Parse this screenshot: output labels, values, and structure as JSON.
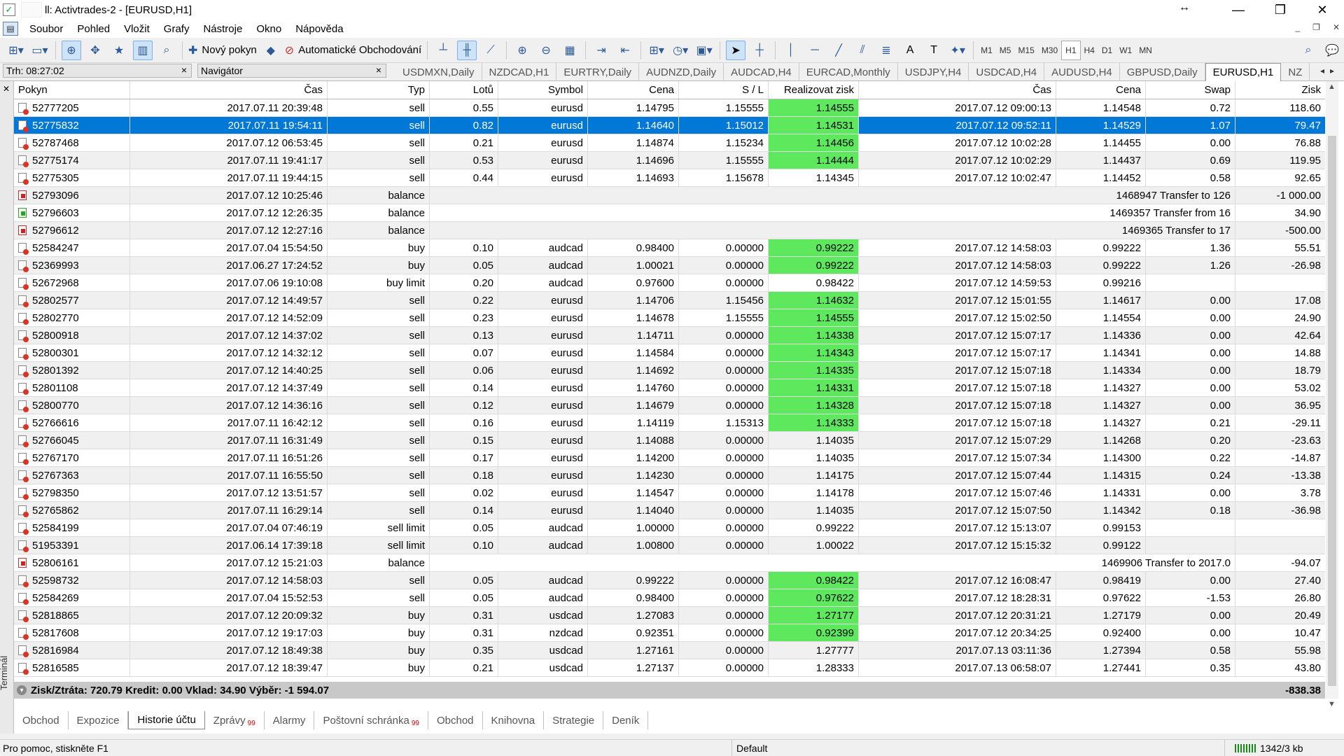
{
  "window": {
    "title": "ll: Activtrades-2 - [EURUSD,H1]",
    "sizer_glyph": "↔",
    "buttons": [
      "—",
      "❐",
      "✕"
    ]
  },
  "menu": [
    "Soubor",
    "Pohled",
    "Vložit",
    "Grafy",
    "Nástroje",
    "Okno",
    "Nápověda"
  ],
  "mdi_buttons": [
    "_",
    "❐",
    "✕"
  ],
  "toolbar": {
    "new_order_label": "Nový pokyn",
    "auto_trading_label": "Automatické Obchodování",
    "timeframes": [
      "M1",
      "M5",
      "M15",
      "M30",
      "H1",
      "H4",
      "D1",
      "W1",
      "MN"
    ],
    "active_timeframe": "H1"
  },
  "panels": {
    "market_watch": "Trh: 08:27:02",
    "navigator": "Navigátor",
    "close_glyph": "×"
  },
  "chart_tabs": [
    "USDMXN,Daily",
    "NZDCAD,H1",
    "EURTRY,Daily",
    "AUDNZD,Daily",
    "AUDCAD,H4",
    "EURCAD,Monthly",
    "USDJPY,H4",
    "USDCAD,H4",
    "AUDUSD,H4",
    "GBPUSD,Daily",
    "EURUSD,H1",
    "NZ"
  ],
  "active_chart_tab": "EURUSD,H1",
  "columns": [
    "Pokyn",
    "Čas",
    "Typ",
    "Lotů",
    "Symbol",
    "Cena",
    "S / L",
    "Realizovat zisk",
    "Čas",
    "Cena",
    "Swap",
    "Zisk"
  ],
  "rows": [
    {
      "kind": "trade",
      "order": "52777205",
      "open_time": "2017.07.11 20:39:48",
      "type": "sell",
      "lots": "0.55",
      "symbol": "eurusd",
      "open_price": "1.14795",
      "sl": "1.15555",
      "tp": "1.14555",
      "tp_hit": true,
      "close_time": "2017.07.12 09:00:13",
      "close_price": "1.14548",
      "swap": "0.72",
      "profit": "118.60"
    },
    {
      "kind": "trade",
      "order": "52775832",
      "open_time": "2017.07.11 19:54:11",
      "type": "sell",
      "lots": "0.82",
      "symbol": "eurusd",
      "open_price": "1.14640",
      "sl": "1.15012",
      "tp": "1.14531",
      "tp_hit": true,
      "close_time": "2017.07.12 09:52:11",
      "close_price": "1.14529",
      "swap": "1.07",
      "profit": "79.47",
      "selected": true
    },
    {
      "kind": "trade",
      "order": "52787468",
      "open_time": "2017.07.12 06:53:45",
      "type": "sell",
      "lots": "0.21",
      "symbol": "eurusd",
      "open_price": "1.14874",
      "sl": "1.15234",
      "tp": "1.14456",
      "tp_hit": true,
      "close_time": "2017.07.12 10:02:28",
      "close_price": "1.14455",
      "swap": "0.00",
      "profit": "76.88"
    },
    {
      "kind": "trade",
      "order": "52775174",
      "open_time": "2017.07.11 19:41:17",
      "type": "sell",
      "lots": "0.53",
      "symbol": "eurusd",
      "open_price": "1.14696",
      "sl": "1.15555",
      "tp": "1.14444",
      "tp_hit": true,
      "close_time": "2017.07.12 10:02:29",
      "close_price": "1.14437",
      "swap": "0.69",
      "profit": "119.95"
    },
    {
      "kind": "trade",
      "order": "52775305",
      "open_time": "2017.07.11 19:44:15",
      "type": "sell",
      "lots": "0.44",
      "symbol": "eurusd",
      "open_price": "1.14693",
      "sl": "1.15678",
      "tp": "1.14345",
      "tp_hit": false,
      "close_time": "2017.07.12 10:02:47",
      "close_price": "1.14452",
      "swap": "0.58",
      "profit": "92.65"
    },
    {
      "kind": "balance",
      "order": "52793096",
      "open_time": "2017.07.12 10:25:46",
      "type": "balance",
      "note": "1468947 Transfer to 126",
      "profit": "-1 000.00",
      "icon": "red"
    },
    {
      "kind": "balance",
      "order": "52796603",
      "open_time": "2017.07.12 12:26:35",
      "type": "balance",
      "note": "1469357 Transfer from 16",
      "profit": "34.90",
      "icon": "green"
    },
    {
      "kind": "balance",
      "order": "52796612",
      "open_time": "2017.07.12 12:27:16",
      "type": "balance",
      "note": "1469365 Transfer to 17",
      "profit": "-500.00",
      "icon": "red"
    },
    {
      "kind": "trade",
      "order": "52584247",
      "open_time": "2017.07.04 15:54:50",
      "type": "buy",
      "lots": "0.10",
      "symbol": "audcad",
      "open_price": "0.98400",
      "sl": "0.00000",
      "tp": "0.99222",
      "tp_hit": true,
      "close_time": "2017.07.12 14:58:03",
      "close_price": "0.99222",
      "swap": "1.36",
      "profit": "55.51"
    },
    {
      "kind": "trade",
      "order": "52369993",
      "open_time": "2017.06.27 17:24:52",
      "type": "buy",
      "lots": "0.05",
      "symbol": "audcad",
      "open_price": "1.00021",
      "sl": "0.00000",
      "tp": "0.99222",
      "tp_hit": true,
      "close_time": "2017.07.12 14:58:03",
      "close_price": "0.99222",
      "swap": "1.26",
      "profit": "-26.98"
    },
    {
      "kind": "trade",
      "order": "52672968",
      "open_time": "2017.07.06 19:10:08",
      "type": "buy limit",
      "lots": "0.20",
      "symbol": "audcad",
      "open_price": "0.97600",
      "sl": "0.00000",
      "tp": "0.98422",
      "tp_hit": false,
      "close_time": "2017.07.12 14:59:53",
      "close_price": "0.99216",
      "swap": "",
      "profit": ""
    },
    {
      "kind": "trade",
      "order": "52802577",
      "open_time": "2017.07.12 14:49:57",
      "type": "sell",
      "lots": "0.22",
      "symbol": "eurusd",
      "open_price": "1.14706",
      "sl": "1.15456",
      "tp": "1.14632",
      "tp_hit": true,
      "close_time": "2017.07.12 15:01:55",
      "close_price": "1.14617",
      "swap": "0.00",
      "profit": "17.08"
    },
    {
      "kind": "trade",
      "order": "52802770",
      "open_time": "2017.07.12 14:52:09",
      "type": "sell",
      "lots": "0.23",
      "symbol": "eurusd",
      "open_price": "1.14678",
      "sl": "1.15555",
      "tp": "1.14555",
      "tp_hit": true,
      "close_time": "2017.07.12 15:02:50",
      "close_price": "1.14554",
      "swap": "0.00",
      "profit": "24.90"
    },
    {
      "kind": "trade",
      "order": "52800918",
      "open_time": "2017.07.12 14:37:02",
      "type": "sell",
      "lots": "0.13",
      "symbol": "eurusd",
      "open_price": "1.14711",
      "sl": "0.00000",
      "tp": "1.14338",
      "tp_hit": true,
      "close_time": "2017.07.12 15:07:17",
      "close_price": "1.14336",
      "swap": "0.00",
      "profit": "42.64"
    },
    {
      "kind": "trade",
      "order": "52800301",
      "open_time": "2017.07.12 14:32:12",
      "type": "sell",
      "lots": "0.07",
      "symbol": "eurusd",
      "open_price": "1.14584",
      "sl": "0.00000",
      "tp": "1.14343",
      "tp_hit": true,
      "close_time": "2017.07.12 15:07:17",
      "close_price": "1.14341",
      "swap": "0.00",
      "profit": "14.88"
    },
    {
      "kind": "trade",
      "order": "52801392",
      "open_time": "2017.07.12 14:40:25",
      "type": "sell",
      "lots": "0.06",
      "symbol": "eurusd",
      "open_price": "1.14692",
      "sl": "0.00000",
      "tp": "1.14335",
      "tp_hit": true,
      "close_time": "2017.07.12 15:07:18",
      "close_price": "1.14334",
      "swap": "0.00",
      "profit": "18.79"
    },
    {
      "kind": "trade",
      "order": "52801108",
      "open_time": "2017.07.12 14:37:49",
      "type": "sell",
      "lots": "0.14",
      "symbol": "eurusd",
      "open_price": "1.14760",
      "sl": "0.00000",
      "tp": "1.14331",
      "tp_hit": true,
      "close_time": "2017.07.12 15:07:18",
      "close_price": "1.14327",
      "swap": "0.00",
      "profit": "53.02"
    },
    {
      "kind": "trade",
      "order": "52800770",
      "open_time": "2017.07.12 14:36:16",
      "type": "sell",
      "lots": "0.12",
      "symbol": "eurusd",
      "open_price": "1.14679",
      "sl": "0.00000",
      "tp": "1.14328",
      "tp_hit": true,
      "close_time": "2017.07.12 15:07:18",
      "close_price": "1.14327",
      "swap": "0.00",
      "profit": "36.95"
    },
    {
      "kind": "trade",
      "order": "52766616",
      "open_time": "2017.07.11 16:42:12",
      "type": "sell",
      "lots": "0.16",
      "symbol": "eurusd",
      "open_price": "1.14119",
      "sl": "1.15313",
      "tp": "1.14333",
      "tp_hit": true,
      "close_time": "2017.07.12 15:07:18",
      "close_price": "1.14327",
      "swap": "0.21",
      "profit": "-29.11"
    },
    {
      "kind": "trade",
      "order": "52766045",
      "open_time": "2017.07.11 16:31:49",
      "type": "sell",
      "lots": "0.15",
      "symbol": "eurusd",
      "open_price": "1.14088",
      "sl": "0.00000",
      "tp": "1.14035",
      "tp_hit": false,
      "close_time": "2017.07.12 15:07:29",
      "close_price": "1.14268",
      "swap": "0.20",
      "profit": "-23.63"
    },
    {
      "kind": "trade",
      "order": "52767170",
      "open_time": "2017.07.11 16:51:26",
      "type": "sell",
      "lots": "0.17",
      "symbol": "eurusd",
      "open_price": "1.14200",
      "sl": "0.00000",
      "tp": "1.14035",
      "tp_hit": false,
      "close_time": "2017.07.12 15:07:34",
      "close_price": "1.14300",
      "swap": "0.22",
      "profit": "-14.87"
    },
    {
      "kind": "trade",
      "order": "52767363",
      "open_time": "2017.07.11 16:55:50",
      "type": "sell",
      "lots": "0.18",
      "symbol": "eurusd",
      "open_price": "1.14230",
      "sl": "0.00000",
      "tp": "1.14175",
      "tp_hit": false,
      "close_time": "2017.07.12 15:07:44",
      "close_price": "1.14315",
      "swap": "0.24",
      "profit": "-13.38"
    },
    {
      "kind": "trade",
      "order": "52798350",
      "open_time": "2017.07.12 13:51:57",
      "type": "sell",
      "lots": "0.02",
      "symbol": "eurusd",
      "open_price": "1.14547",
      "sl": "0.00000",
      "tp": "1.14178",
      "tp_hit": false,
      "close_time": "2017.07.12 15:07:46",
      "close_price": "1.14331",
      "swap": "0.00",
      "profit": "3.78"
    },
    {
      "kind": "trade",
      "order": "52765862",
      "open_time": "2017.07.11 16:29:14",
      "type": "sell",
      "lots": "0.14",
      "symbol": "eurusd",
      "open_price": "1.14040",
      "sl": "0.00000",
      "tp": "1.14035",
      "tp_hit": false,
      "close_time": "2017.07.12 15:07:50",
      "close_price": "1.14342",
      "swap": "0.18",
      "profit": "-36.98"
    },
    {
      "kind": "trade",
      "order": "52584199",
      "open_time": "2017.07.04 07:46:19",
      "type": "sell limit",
      "lots": "0.05",
      "symbol": "audcad",
      "open_price": "1.00000",
      "sl": "0.00000",
      "tp": "0.99222",
      "tp_hit": false,
      "close_time": "2017.07.12 15:13:07",
      "close_price": "0.99153",
      "swap": "",
      "profit": ""
    },
    {
      "kind": "trade",
      "order": "51953391",
      "open_time": "2017.06.14 17:39:18",
      "type": "sell limit",
      "lots": "0.10",
      "symbol": "audcad",
      "open_price": "1.00800",
      "sl": "0.00000",
      "tp": "1.00022",
      "tp_hit": false,
      "close_time": "2017.07.12 15:15:32",
      "close_price": "0.99122",
      "swap": "",
      "profit": ""
    },
    {
      "kind": "balance",
      "order": "52806161",
      "open_time": "2017.07.12 15:21:03",
      "type": "balance",
      "note": "1469906 Transfer to 2017.0",
      "profit": "-94.07",
      "icon": "red"
    },
    {
      "kind": "trade",
      "order": "52598732",
      "open_time": "2017.07.12 14:58:03",
      "type": "sell",
      "lots": "0.05",
      "symbol": "audcad",
      "open_price": "0.99222",
      "sl": "0.00000",
      "tp": "0.98422",
      "tp_hit": true,
      "close_time": "2017.07.12 16:08:47",
      "close_price": "0.98419",
      "swap": "0.00",
      "profit": "27.40"
    },
    {
      "kind": "trade",
      "order": "52584269",
      "open_time": "2017.07.04 15:52:53",
      "type": "sell",
      "lots": "0.05",
      "symbol": "audcad",
      "open_price": "0.98400",
      "sl": "0.00000",
      "tp": "0.97622",
      "tp_hit": true,
      "close_time": "2017.07.12 18:28:31",
      "close_price": "0.97622",
      "swap": "-1.53",
      "profit": "26.80"
    },
    {
      "kind": "trade",
      "order": "52818865",
      "open_time": "2017.07.12 20:09:32",
      "type": "buy",
      "lots": "0.31",
      "symbol": "usdcad",
      "open_price": "1.27083",
      "sl": "0.00000",
      "tp": "1.27177",
      "tp_hit": true,
      "close_time": "2017.07.12 20:31:21",
      "close_price": "1.27179",
      "swap": "0.00",
      "profit": "20.49"
    },
    {
      "kind": "trade",
      "order": "52817608",
      "open_time": "2017.07.12 19:17:03",
      "type": "buy",
      "lots": "0.31",
      "symbol": "nzdcad",
      "open_price": "0.92351",
      "sl": "0.00000",
      "tp": "0.92399",
      "tp_hit": true,
      "close_time": "2017.07.12 20:34:25",
      "close_price": "0.92400",
      "swap": "0.00",
      "profit": "10.47"
    },
    {
      "kind": "trade",
      "order": "52816984",
      "open_time": "2017.07.12 18:49:38",
      "type": "buy",
      "lots": "0.35",
      "symbol": "usdcad",
      "open_price": "1.27161",
      "sl": "0.00000",
      "tp": "1.27777",
      "tp_hit": false,
      "close_time": "2017.07.13 03:11:36",
      "close_price": "1.27394",
      "swap": "0.58",
      "profit": "55.98"
    },
    {
      "kind": "trade",
      "order": "52816585",
      "open_time": "2017.07.12 18:39:47",
      "type": "buy",
      "lots": "0.21",
      "symbol": "usdcad",
      "open_price": "1.27137",
      "sl": "0.00000",
      "tp": "1.28333",
      "tp_hit": false,
      "close_time": "2017.07.13 06:58:07",
      "close_price": "1.27441",
      "swap": "0.35",
      "profit": "43.80"
    }
  ],
  "summary": {
    "text": "Zisk/Ztráta: 720.79  Kredit: 0.00  Vklad: 34.90  Výběr: -1 594.07",
    "total": "-838.38"
  },
  "bottom_tabs": [
    {
      "label": "Obchod",
      "count": ""
    },
    {
      "label": "Expozice",
      "count": ""
    },
    {
      "label": "Historie účtu",
      "count": "",
      "active": true
    },
    {
      "label": "Zprávy",
      "count": "99"
    },
    {
      "label": "Alarmy",
      "count": ""
    },
    {
      "label": "Poštovní schránka",
      "count": "99"
    },
    {
      "label": "Obchod",
      "count": ""
    },
    {
      "label": "Knihovna",
      "count": ""
    },
    {
      "label": "Strategie",
      "count": ""
    },
    {
      "label": "Deník",
      "count": ""
    }
  ],
  "terminal_label": "Terminál",
  "status": {
    "help": "Pro pomoc, stiskněte F1",
    "profile": "Default",
    "connection": "1342/3 kb"
  },
  "colors": {
    "selection": "#0078d7",
    "tp_hit": "#5de85d"
  }
}
